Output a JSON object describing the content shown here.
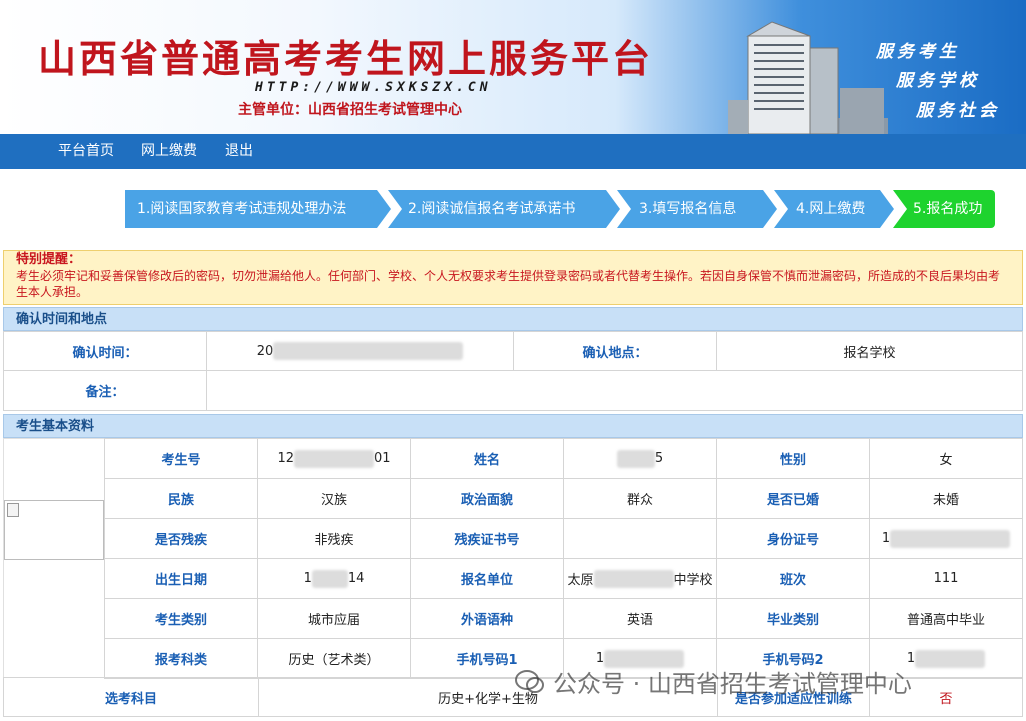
{
  "banner": {
    "title": "山西省普通高考考生网上服务平台",
    "url": "HTTP://WWW.SXKSZX.CN",
    "org": "主管单位：山西省招生考试管理中心",
    "slogans": [
      "服务考生",
      "服务学校",
      "服务社会"
    ]
  },
  "nav": {
    "items": [
      "平台首页",
      "网上缴费",
      "退出"
    ]
  },
  "steps": [
    "1.阅读国家教育考试违规处理办法",
    "2.阅读诚信报名考试承诺书",
    "3.填写报名信息",
    "4.网上缴费",
    "5.报名成功"
  ],
  "notice": {
    "title": "特别提醒：",
    "body": "考生必须牢记和妥善保管修改后的密码，切勿泄漏给他人。任何部门、学校、个人无权要求考生提供登录密码或者代替考生操作。若因自身保管不慎而泄漏密码，所造成的不良后果均由考生本人承担。"
  },
  "confirm": {
    "heading": "确认时间和地点",
    "time_label": "确认时间：",
    "time_value_prefix": "20",
    "place_label": "确认地点：",
    "place_value": "报名学校",
    "remark_label": "备注：",
    "remark_value": ""
  },
  "basic": {
    "heading": "考生基本资料",
    "rows": [
      [
        {
          "l": "考生号",
          "v1": "12",
          "v2": "01"
        },
        {
          "l": "姓名",
          "v1": "",
          "v2": "5"
        },
        {
          "l": "性别",
          "v1": "女",
          "v2": ""
        }
      ],
      [
        {
          "l": "民族",
          "v1": "汉族",
          "v2": ""
        },
        {
          "l": "政治面貌",
          "v1": "群众",
          "v2": ""
        },
        {
          "l": "是否已婚",
          "v1": "未婚",
          "v2": ""
        }
      ],
      [
        {
          "l": "是否残疾",
          "v1": "非残疾",
          "v2": ""
        },
        {
          "l": "残疾证书号",
          "v1": "",
          "v2": ""
        },
        {
          "l": "身份证号",
          "v1": "1",
          "v2": ""
        }
      ],
      [
        {
          "l": "出生日期",
          "v1": "1",
          "v2": "14"
        },
        {
          "l": "报名单位",
          "v1": "太原",
          "v2": "中学校"
        },
        {
          "l": "班次",
          "v1": "111",
          "v2": ""
        }
      ],
      [
        {
          "l": "考生类别",
          "v1": "城市应届",
          "v2": ""
        },
        {
          "l": "外语语种",
          "v1": "英语",
          "v2": ""
        },
        {
          "l": "毕业类别",
          "v1": "普通高中毕业",
          "v2": ""
        }
      ],
      [
        {
          "l": "报考科类",
          "v1": "历史（艺术类）",
          "v2": ""
        },
        {
          "l": "手机号码1",
          "v1": "1",
          "v2": ""
        },
        {
          "l": "手机号码2",
          "v1": "1",
          "v2": ""
        }
      ]
    ],
    "subjects_label": "选考科目",
    "subjects_value": "历史+化学+生物",
    "train_label": "是否参加适应性训练",
    "train_value": "否"
  },
  "watermark": "公众号 · 山西省招生考试管理中心",
  "colors": {
    "brand_red": "#c0151d",
    "nav_blue": "#1f6fc0",
    "step_blue": "#4aa3e6",
    "step_green": "#1ed32e",
    "label_blue": "#1a5fb4"
  }
}
